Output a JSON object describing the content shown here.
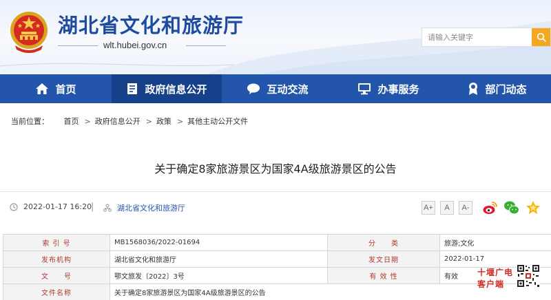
{
  "header": {
    "site_title": "湖北省文化和旅游厅",
    "site_url": "wlt.hubei.gov.cn",
    "search_placeholder": "请输入关键字",
    "brand_color": "#1e4aa0"
  },
  "nav": {
    "items": [
      {
        "label": "首页",
        "icon": "home-icon"
      },
      {
        "label": "政府信息公开",
        "icon": "document-icon",
        "active": true
      },
      {
        "label": "互动交流",
        "icon": "chat-icon"
      },
      {
        "label": "办事服务",
        "icon": "monitor-icon"
      },
      {
        "label": "部门动态",
        "icon": "award-icon"
      }
    ],
    "bg_color": "#2356ab",
    "active_color": "#16408a"
  },
  "breadcrumb": {
    "prefix": "当前位置：",
    "items": [
      "首页",
      "政府信息公开",
      "政策",
      "其他主动公开文件"
    ],
    "separator": ">"
  },
  "article": {
    "title": "关于确定8家旅游景区为国家4A级旅游景区的公告",
    "datetime": "2022-01-17 16:20",
    "source": "湖北省文化和旅游厅",
    "font_sizes": [
      "A+",
      "A",
      "A-"
    ],
    "share_icons": [
      "weibo-icon",
      "wechat-icon",
      "favorite-star-icon"
    ]
  },
  "info_table": {
    "rows": [
      [
        {
          "label": "索 引 号",
          "value": "MB1568036/2022-01694"
        },
        {
          "label": "分　　类",
          "value": "旅游;文化"
        }
      ],
      [
        {
          "label": "发布机构",
          "value": "湖北省文化和旅游厅"
        },
        {
          "label": "发文日期",
          "value": "2022-01-17"
        }
      ],
      [
        {
          "label": "文　　号",
          "value": "鄂文旅发〔2022〕3号"
        },
        {
          "label": "有 效 性",
          "value": "有效"
        }
      ],
      [
        {
          "label": "文件名称",
          "value": "关于确定8家旅游景区为国家4A级旅游景区的公告"
        }
      ]
    ]
  },
  "watermark": {
    "line1": "十堰广电",
    "line2": "客户端"
  }
}
